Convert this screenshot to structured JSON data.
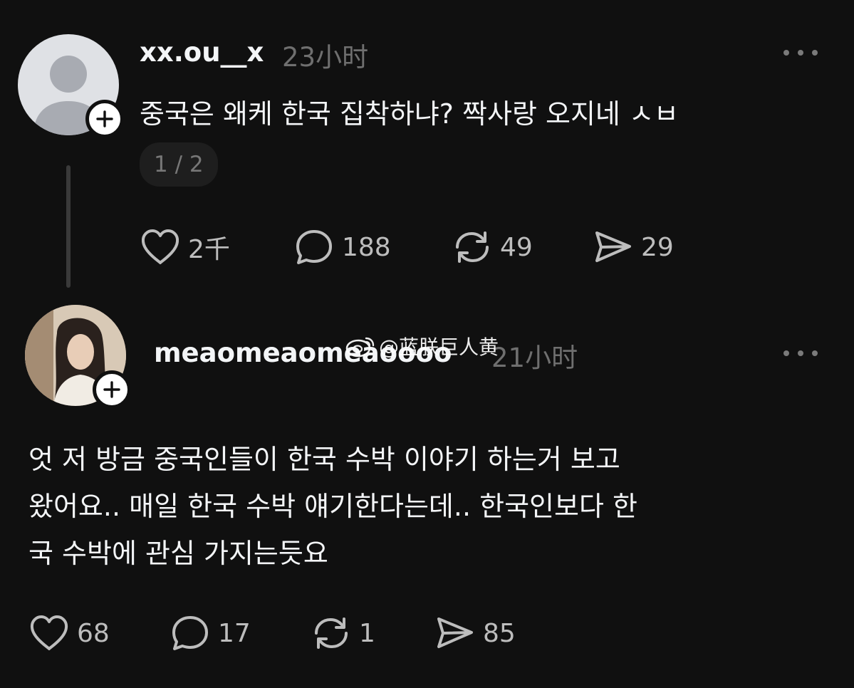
{
  "posts": [
    {
      "username": "xx.ou__x",
      "time": "23小时",
      "text": [
        "중국은 왜케 한국 집착하냐? 짝사랑 오지네 ㅅㅂ"
      ],
      "pager": "1 / 2",
      "stats": {
        "likes": "2千",
        "replies": "188",
        "reposts": "49",
        "shares": "29"
      }
    },
    {
      "username": "meaomeaomeaoooo",
      "time": "21小时",
      "text": [
        "엇 저 방금 중국인들이 한국 수박 이야기 하는거 보고",
        "왔어요.. 매일 한국 수박 얘기한다는데.. 한국인보다 한",
        "국 수박에 관심 가지는듯요"
      ],
      "stats": {
        "likes": "68",
        "replies": "17",
        "reposts": "1",
        "shares": "85"
      }
    }
  ],
  "watermark": "@蓝朕巨人黄",
  "colors": {
    "background": "#101010",
    "text": "#f3f5f7",
    "muted": "#6f6f6f",
    "icon": "#bdbdbd"
  }
}
